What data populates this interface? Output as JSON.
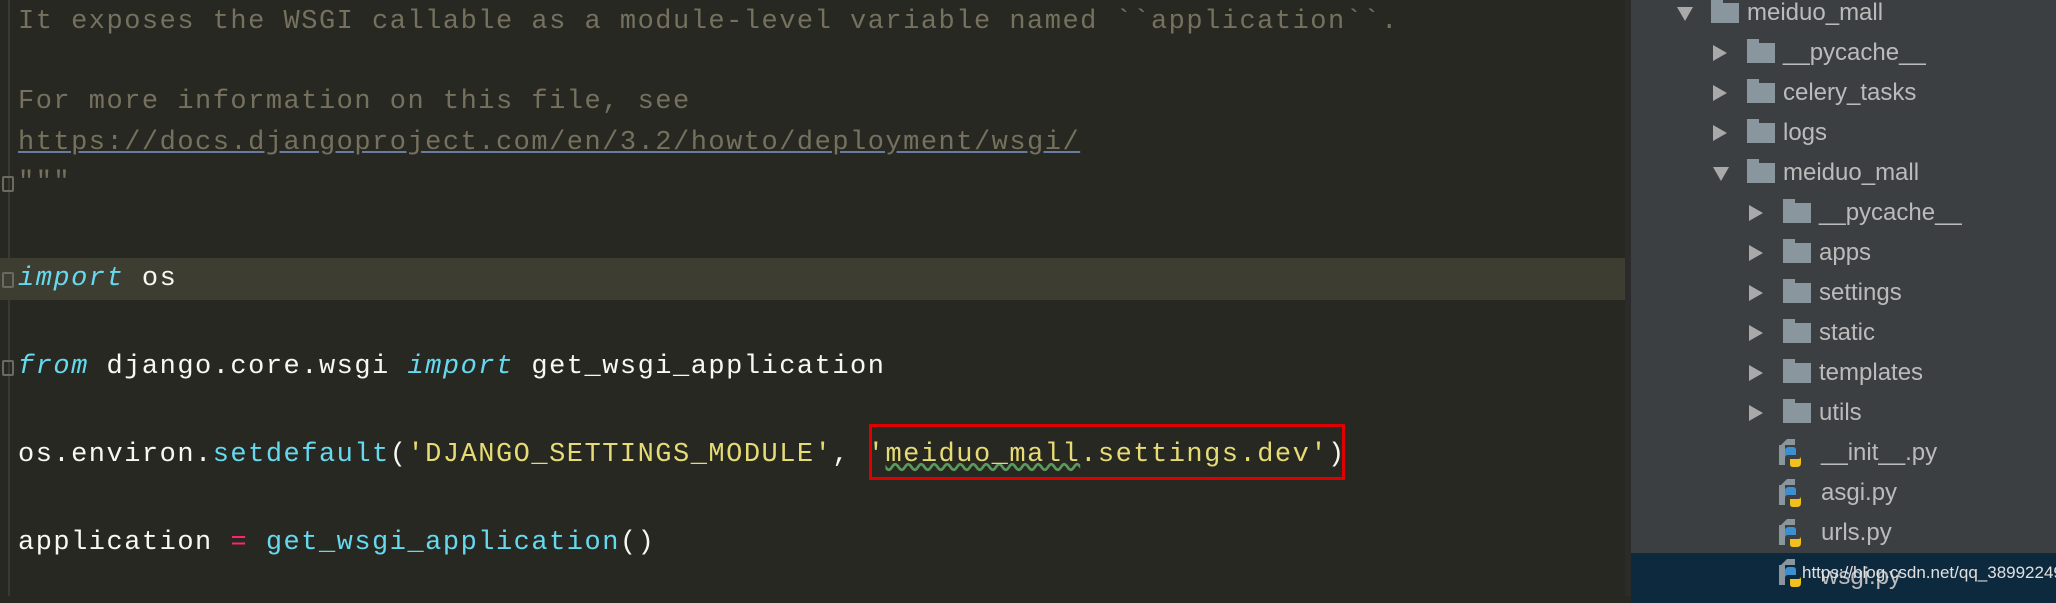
{
  "editor": {
    "lines": {
      "doc1": "It exposes the WSGI callable as a module-level variable named ``application``.",
      "doc2": "For more information on this file, see",
      "doc3_link": "https://docs.djangoproject.com/en/3.2/howto/deployment/wsgi/",
      "doc4": "\"\"\"",
      "import_kw": "import",
      "import_mod": " os",
      "from_kw": "from",
      "from_mod": " django.core.wsgi ",
      "from_import_kw": "import",
      "from_name": " get_wsgi_application",
      "environ_obj": "os.environ.",
      "environ_fn": "setdefault",
      "paren_open": "(",
      "environ_key": "'DJANGO_SETTINGS_MODULE'",
      "comma": ", ",
      "environ_val_q1": "'",
      "environ_val_typo": "meiduo_mall",
      "environ_val_rest": ".settings.dev'",
      "paren_close": ")",
      "app_var": "application ",
      "app_op": "=",
      "app_fn": " get_wsgi_application",
      "app_call": "()"
    },
    "highlight_color": "#e00000"
  },
  "tree": {
    "items": [
      {
        "label": "meiduo_mall",
        "type": "folder",
        "expanded": true
      },
      {
        "label": "__pycache__",
        "type": "folder",
        "expanded": false
      },
      {
        "label": "celery_tasks",
        "type": "folder",
        "expanded": false
      },
      {
        "label": "logs",
        "type": "folder",
        "expanded": false
      },
      {
        "label": "meiduo_mall",
        "type": "folder",
        "expanded": true
      },
      {
        "label": "__pycache__",
        "type": "folder",
        "expanded": false
      },
      {
        "label": "apps",
        "type": "folder",
        "expanded": false
      },
      {
        "label": "settings",
        "type": "folder",
        "expanded": false
      },
      {
        "label": "static",
        "type": "folder",
        "expanded": false
      },
      {
        "label": "templates",
        "type": "folder",
        "expanded": false
      },
      {
        "label": "utils",
        "type": "folder",
        "expanded": false
      },
      {
        "label": "__init__.py",
        "type": "python-file"
      },
      {
        "label": "asgi.py",
        "type": "python-file"
      },
      {
        "label": "urls.py",
        "type": "python-file"
      },
      {
        "label": "wsgi.py",
        "type": "python-file",
        "selected": true
      }
    ]
  },
  "watermark": "https://blog.csdn.net/qq_38992249"
}
